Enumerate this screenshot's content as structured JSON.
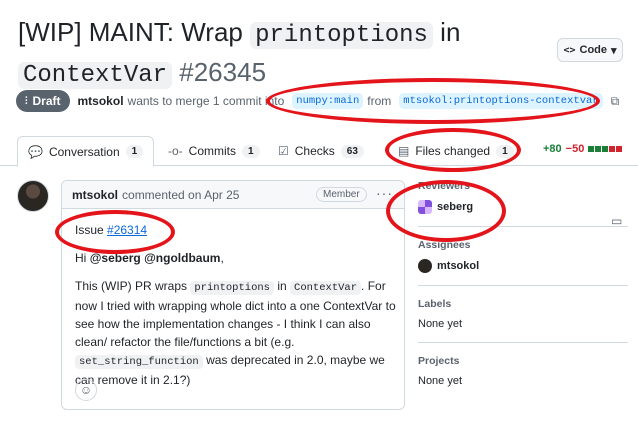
{
  "pr": {
    "title_prefix": "[WIP] MAINT: Wrap ",
    "title_code1": "printoptions",
    "title_mid": " in",
    "title_code2": "ContextVar",
    "number": "#26345",
    "state": "Draft",
    "author": "mtsokol",
    "merge_text": "wants to merge 1 commit into",
    "base_branch": "numpy:main",
    "from_text": "from",
    "head_branch": "mtsokol:printoptions-contextvar"
  },
  "code_button": {
    "label": "Code",
    "icon": "code-icon"
  },
  "tabs": [
    {
      "label": "Conversation",
      "count": "1",
      "icon": "comment-discussion-icon"
    },
    {
      "label": "Commits",
      "count": "1",
      "icon": "git-commit-icon"
    },
    {
      "label": "Checks",
      "count": "63",
      "icon": "checklist-icon"
    },
    {
      "label": "Files changed",
      "count": "1",
      "icon": "file-diff-icon"
    }
  ],
  "diffstat": {
    "additions": "+80",
    "deletions": "−50",
    "add_color": "#1a7f37",
    "del_color": "#d1242f",
    "neutral_color": "#d1d9e0"
  },
  "comment": {
    "author": "mtsokol",
    "meta": "commented on Apr 25",
    "badge": "Member",
    "issue_label": "Issue",
    "issue_link": "#26314",
    "greeting_prefix": "Hi",
    "mention1": "@seberg",
    "mention2": "@ngoldbaum",
    "greeting_suffix": ",",
    "body_1": "This (WIP) PR wraps",
    "body_code1": "printoptions",
    "body_2": "in",
    "body_code2": "ContextVar",
    "body_3": ". For now I tried with wrapping whole dict into a one ContextVar to see how the implementation changes - I think I can also clean/ refactor the file/functions a bit (e.g.",
    "body_code3": "set_string_function",
    "body_4": "was deprecated in 2.0, maybe we can remove it in 2.1?)"
  },
  "sidebar": {
    "reviewers_heading": "Reviewers",
    "reviewer": "seberg",
    "assignees_heading": "Assignees",
    "assignee": "mtsokol",
    "labels_heading": "Labels",
    "labels_value": "None yet",
    "projects_heading": "Projects",
    "projects_value": "None yet"
  },
  "annotation_color": "#e4141b"
}
